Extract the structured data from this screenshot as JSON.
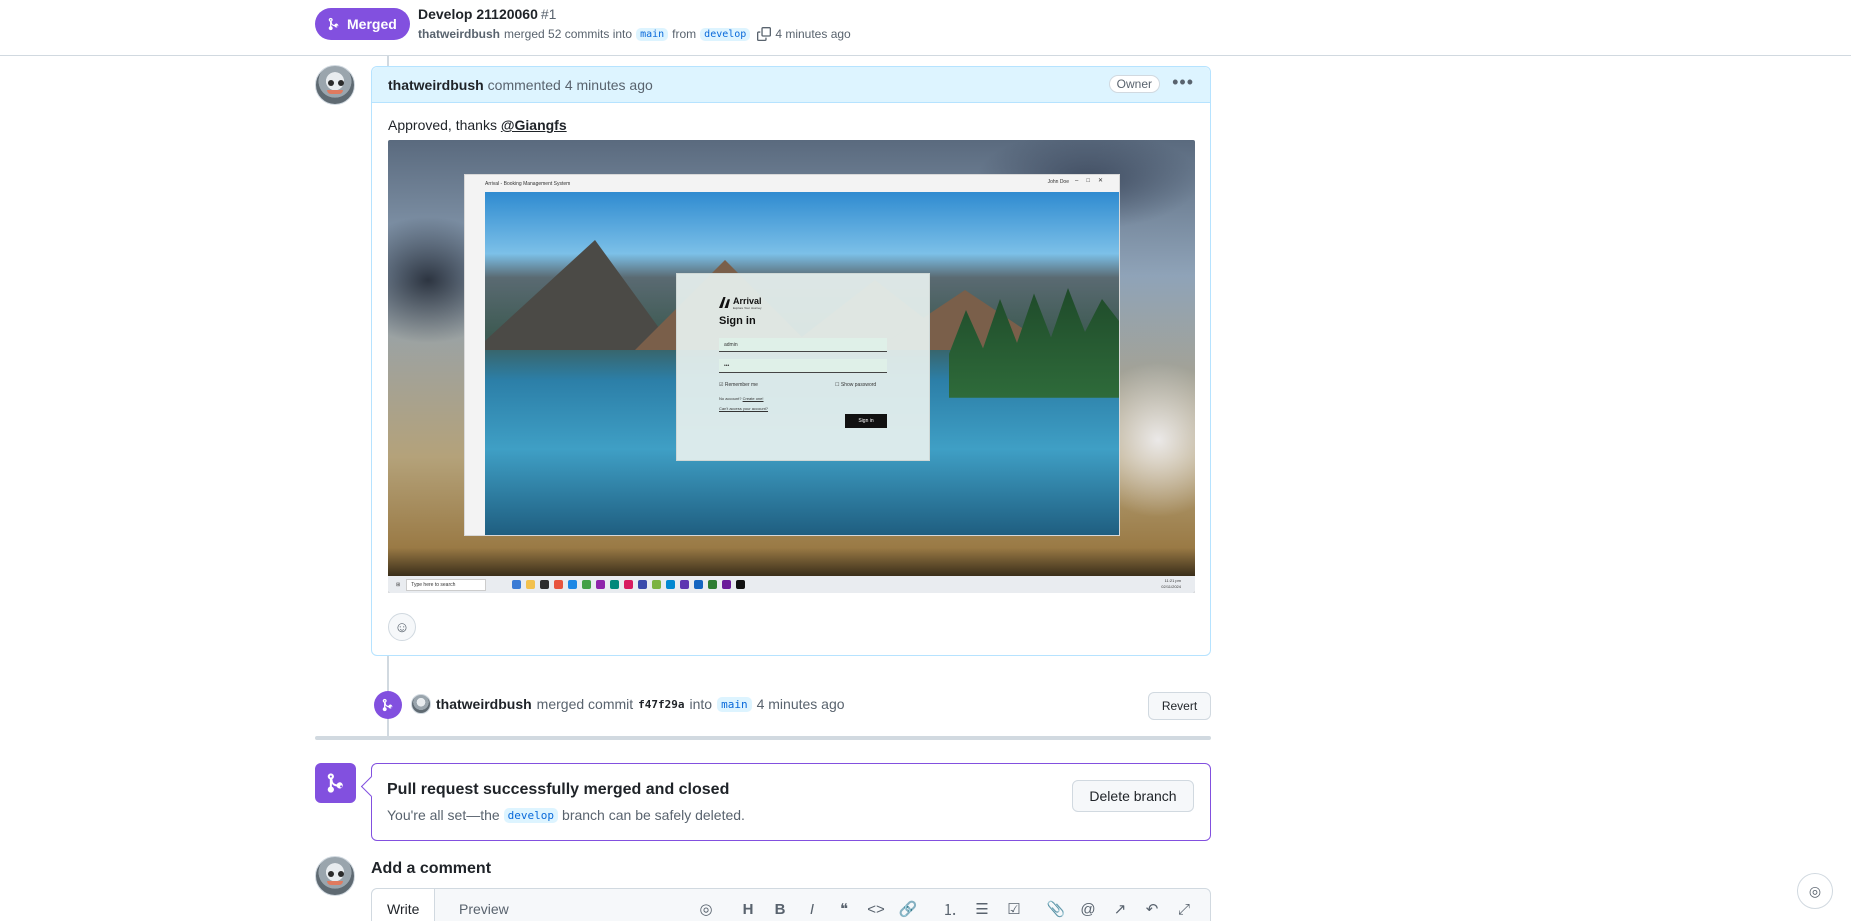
{
  "header": {
    "status_label": "Merged",
    "title": "Develop 21120060",
    "number": "#1",
    "author": "thatweirdbush",
    "merged_text": "merged 52 commits into",
    "base_branch": "main",
    "from_text": "from",
    "head_branch": "develop",
    "time": "4 minutes ago"
  },
  "comment": {
    "author": "thatweirdbush",
    "action": "commented",
    "time": "4 minutes ago",
    "role_badge": "Owner",
    "body_text": "Approved, thanks",
    "mention": "@Giangfs",
    "screenshot": {
      "app_title": "Arrival - Booking Management System",
      "user_name": "John Doe",
      "brand": "Arrival",
      "brand_tagline": "Explore Your Journey",
      "heading": "Sign in",
      "username_value": "admin",
      "password_value": "•••",
      "remember_label": "Remember me",
      "show_password_label": "Show password",
      "no_account_text": "No account?",
      "create_one_link": "Create one!",
      "cant_access_link": "Can't access your account?",
      "signin_button": "Sign in",
      "taskbar_search": "Type here to search",
      "clock_time": "11:21 pm",
      "clock_date": "02/11/2024"
    }
  },
  "merge_event": {
    "author": "thatweirdbush",
    "action": "merged commit",
    "sha": "f47f29a",
    "into_text": "into",
    "branch": "main",
    "time": "4 minutes ago",
    "revert_label": "Revert"
  },
  "merge_box": {
    "title": "Pull request successfully merged and closed",
    "sub_before": "You're all set—the",
    "branch": "develop",
    "sub_after": "branch can be safely deleted.",
    "delete_label": "Delete branch"
  },
  "add_comment": {
    "title": "Add a comment",
    "tab_write": "Write",
    "tab_preview": "Preview"
  },
  "colors": {
    "merged_purple": "#8250df",
    "link_blue": "#0969da",
    "comment_header_bg": "#ddf4ff"
  }
}
